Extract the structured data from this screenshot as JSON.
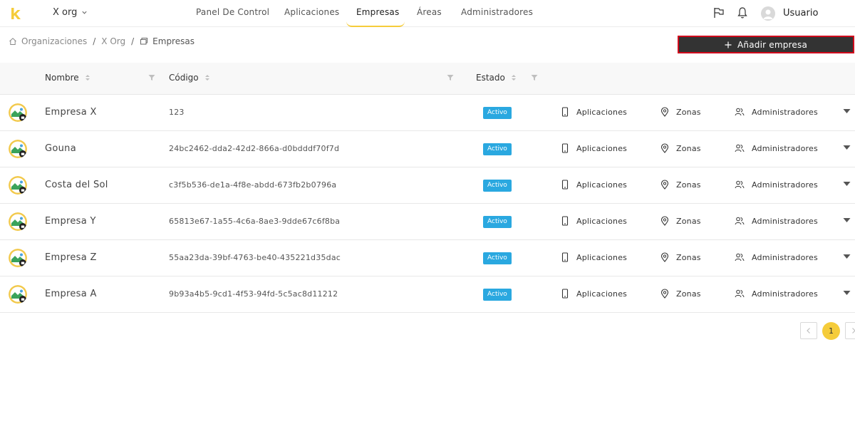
{
  "header": {
    "org_selector": "X org",
    "nav": [
      {
        "label": "Panel De Control"
      },
      {
        "label": "Aplicaciones"
      },
      {
        "label": "Empresas"
      },
      {
        "label": "Áreas"
      },
      {
        "label": "Administradores"
      }
    ],
    "active_nav": "Empresas",
    "user_name": "Usuario"
  },
  "breadcrumb": {
    "items": [
      {
        "label": "Organizaciones"
      },
      {
        "label": "X Org"
      },
      {
        "label": "Empresas"
      }
    ]
  },
  "actions": {
    "add_company": "Añadir empresa"
  },
  "table": {
    "columns": {
      "name": "Nombre",
      "code": "Código",
      "status": "Estado"
    },
    "row_actions": {
      "apps": "Aplicaciones",
      "zones": "Zonas",
      "admins": "Administradores"
    },
    "rows": [
      {
        "name": "Empresa X",
        "code": "123",
        "status": "Activo"
      },
      {
        "name": "Gouna",
        "code": "24bc2462-dda2-42d2-866a-d0bdddf70f7d",
        "status": "Activo"
      },
      {
        "name": "Costa del Sol",
        "code": "c3f5b536-de1a-4f8e-abdd-673fb2b0796a",
        "status": "Activo"
      },
      {
        "name": "Empresa Y",
        "code": "65813e67-1a55-4c6a-8ae3-9dde67c6f8ba",
        "status": "Activo"
      },
      {
        "name": "Empresa Z",
        "code": "55aa23da-39bf-4763-be40-435221d35dac",
        "status": "Activo"
      },
      {
        "name": "Empresa A",
        "code": "9b93a4b5-9cd1-4f53-94fd-5c5ac8d11212",
        "status": "Activo"
      }
    ]
  },
  "pagination": {
    "current_page": "1"
  },
  "colors": {
    "brand_yellow": "#f5cc3a",
    "status_active": "#2aa8e0",
    "primary_button": "#333333",
    "highlight_border": "#d0021b"
  }
}
